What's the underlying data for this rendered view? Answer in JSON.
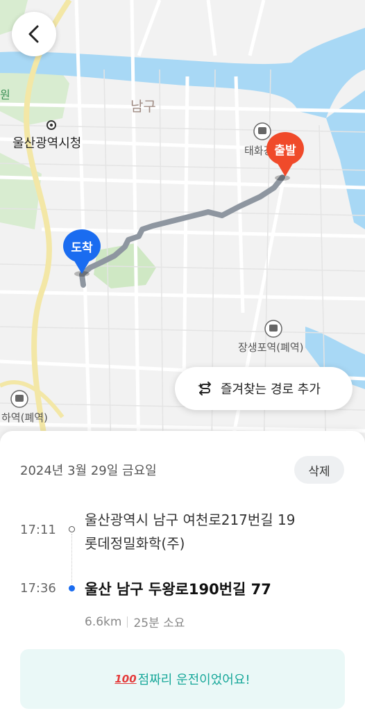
{
  "map": {
    "labels": {
      "district": "남구",
      "city_hall": "울산광역시청",
      "station_top": "태화강",
      "station_right": "장생포역(폐역)",
      "station_left": "하역(폐역)",
      "edge_left": "원"
    },
    "colors": {
      "river": "#a8d8f5",
      "park": "#cfe8c4",
      "route": "#8e96a0",
      "road_major": "#f3e7a6"
    }
  },
  "pins": {
    "start_label": "출발",
    "end_label": "도착"
  },
  "favorite_button": {
    "label": "즐겨찾는 경로 추가"
  },
  "trip": {
    "date": "2024년 3월 29일 금요일",
    "delete_label": "삭제",
    "origin": {
      "time": "17:11",
      "address": "울산광역시 남구 여천로217번길 19",
      "place": "롯데정밀화학(주)"
    },
    "destination": {
      "time": "17:36",
      "address": "울산 남구 두왕로190번길 77"
    },
    "distance": "6.6km",
    "duration": "25분 소요",
    "banner_icon": "100",
    "banner_text": "점짜리 운전이었어요!"
  }
}
